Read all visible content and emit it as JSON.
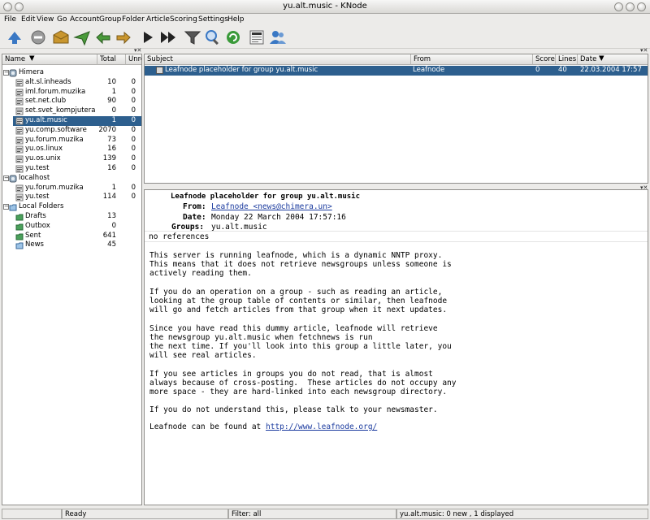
{
  "window": {
    "title": "yu.alt.music - KNode"
  },
  "menu": [
    "File",
    "Edit",
    "View",
    "Go",
    "Account",
    "Group",
    "Folder",
    "Article",
    "Scoring",
    "Settings",
    "Help"
  ],
  "toolbar": {
    "buttons": [
      {
        "name": "go-online-icon",
        "color": "#3a78c4"
      },
      {
        "name": "stop-icon",
        "color": "#9a9a9a"
      },
      {
        "name": "get-new-articles-icon",
        "color": "#c9962e"
      },
      {
        "name": "send-pending-icon",
        "color": "#4a9a3a"
      },
      {
        "name": "reply-icon",
        "color": "#4a9a3a"
      },
      {
        "name": "forward-icon",
        "color": "#c9962e"
      },
      {
        "name": "next-article-icon",
        "color": "#222222"
      },
      {
        "name": "next-unread-icon",
        "color": "#222222"
      },
      {
        "name": "filter-icon",
        "color": "#555555"
      },
      {
        "name": "search-icon",
        "color": "#3a78c4"
      },
      {
        "name": "refresh-icon",
        "color": "#3a9a3a"
      },
      {
        "name": "newsgroups-icon",
        "color": "#666666"
      },
      {
        "name": "accounts-icon",
        "color": "#3a78c4"
      }
    ]
  },
  "folders": {
    "columns": {
      "name": "Name",
      "total": "Total",
      "unread": "Unre"
    },
    "rows": [
      {
        "label": "Himera",
        "total": "",
        "unread": "",
        "level": 0,
        "icon": "server-icon"
      },
      {
        "label": "alt.sl.inheads",
        "total": "10",
        "unread": "0",
        "level": 1,
        "icon": "group-icon"
      },
      {
        "label": "iml.forum.muzika",
        "total": "1",
        "unread": "0",
        "level": 1,
        "icon": "group-icon"
      },
      {
        "label": "set.net.club",
        "total": "90",
        "unread": "0",
        "level": 1,
        "icon": "group-icon"
      },
      {
        "label": "set.svet_kompjutera",
        "total": "0",
        "unread": "0",
        "level": 1,
        "icon": "group-icon"
      },
      {
        "label": "yu.alt.music",
        "total": "1",
        "unread": "0",
        "level": 1,
        "icon": "group-icon",
        "selected": true
      },
      {
        "label": "yu.comp.software",
        "total": "2070",
        "unread": "0",
        "level": 1,
        "icon": "group-icon"
      },
      {
        "label": "yu.forum.muzika",
        "total": "73",
        "unread": "0",
        "level": 1,
        "icon": "group-icon"
      },
      {
        "label": "yu.os.linux",
        "total": "16",
        "unread": "0",
        "level": 1,
        "icon": "group-icon"
      },
      {
        "label": "yu.os.unix",
        "total": "139",
        "unread": "0",
        "level": 1,
        "icon": "group-icon"
      },
      {
        "label": "yu.test",
        "total": "16",
        "unread": "0",
        "level": 1,
        "icon": "group-icon"
      },
      {
        "label": "localhost",
        "total": "",
        "unread": "",
        "level": 0,
        "icon": "server-icon"
      },
      {
        "label": "yu.forum.muzika",
        "total": "1",
        "unread": "0",
        "level": 1,
        "icon": "group-icon"
      },
      {
        "label": "yu.test",
        "total": "114",
        "unread": "0",
        "level": 1,
        "icon": "group-icon"
      },
      {
        "label": "Local Folders",
        "total": "",
        "unread": "",
        "level": 0,
        "icon": "local-folders-icon"
      },
      {
        "label": "Drafts",
        "total": "13",
        "unread": "",
        "level": 1,
        "icon": "drafts-folder-icon"
      },
      {
        "label": "Outbox",
        "total": "0",
        "unread": "",
        "level": 1,
        "icon": "outbox-folder-icon"
      },
      {
        "label": "Sent",
        "total": "641",
        "unread": "",
        "level": 1,
        "icon": "sent-folder-icon"
      },
      {
        "label": "News",
        "total": "45",
        "unread": "",
        "level": 1,
        "icon": "news-folder-icon"
      }
    ]
  },
  "articles": {
    "columns": {
      "subject": "Subject",
      "from": "From",
      "score": "Score",
      "lines": "Lines",
      "date": "Date"
    },
    "rows": [
      {
        "subject": "Leafnode placeholder for group yu.alt.music",
        "from": "Leafnode",
        "score": "0",
        "lines": "40",
        "date": "22.03.2004 17:57"
      }
    ]
  },
  "article": {
    "subject": "Leafnode placeholder for group yu.alt.music",
    "from_label": "From:",
    "from": "Leafnode <news@chimera.un>",
    "date_label": "Date:",
    "date": "Monday 22 March 2004 17:57:16",
    "groups_label": "Groups:",
    "groups": "yu.alt.music",
    "references": "no references",
    "body": [
      "This server is running leafnode, which is a dynamic NNTP proxy.",
      "This means that it does not retrieve newsgroups unless someone is",
      "actively reading them.",
      "",
      "If you do an operation on a group - such as reading an article,",
      "looking at the group table of contents or similar, then leafnode",
      "will go and fetch articles from that group when it next updates.",
      "",
      "Since you have read this dummy article, leafnode will retrieve",
      "the newsgroup yu.alt.music when fetchnews is run",
      "the next time. If you'll look into this group a little later, you",
      "will see real articles.",
      "",
      "If you see articles in groups you do not read, that is almost",
      "always because of cross-posting.  These articles do not occupy any",
      "more space - they are hard-linked into each newsgroup directory.",
      "",
      "If you do not understand this, please talk to your newsmaster.",
      ""
    ],
    "footer_prefix": "Leafnode can be found at ",
    "footer_link": "http://www.leafnode.org/"
  },
  "status": {
    "segment1": "",
    "ready": "Ready",
    "filter": "Filter: all",
    "group_info": "yu.alt.music: 0 new , 1 displayed"
  },
  "colors": {
    "selection": "#2d5f8e",
    "link": "#1a3a9e"
  }
}
